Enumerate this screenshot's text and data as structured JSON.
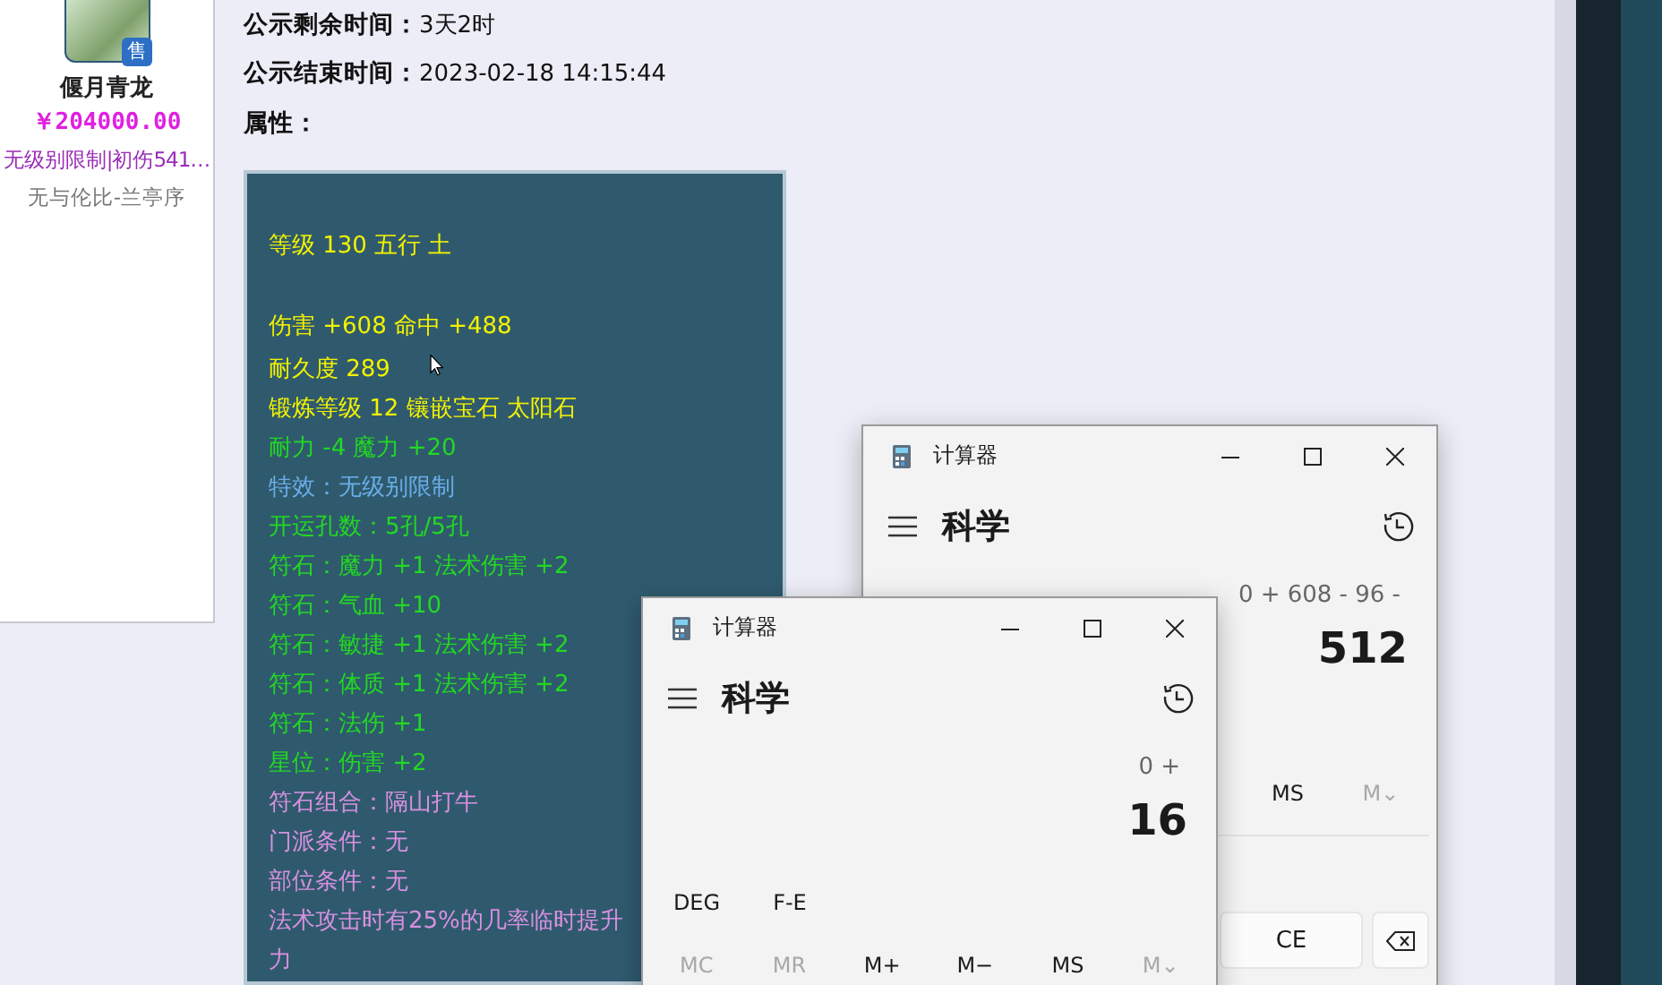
{
  "sidebar": {
    "badge": "售",
    "item_name": "偃月青龙",
    "price": "￥204000.00",
    "tags": "无级别限制|初伤541…",
    "seller": "无与伦比-兰亭序"
  },
  "details": [
    {
      "label": "公示剩余时间：",
      "value": "3天2时"
    },
    {
      "label": "公示结束时间：",
      "value": "2023-02-18 14:15:44"
    }
  ],
  "attributes": {
    "label": "属性：",
    "lines": [
      {
        "text": "等级 130 五行 土",
        "color": "#f2f200",
        "gap_before": true
      },
      {
        "text": "伤害 +608 命中 +488",
        "color": "#f2f200",
        "gap_before": true
      },
      {
        "text": "耐久度 289",
        "color": "#f2f200",
        "gap_before": false
      },
      {
        "text": "锻炼等级 12 镶嵌宝石 太阳石",
        "color": "#f2f200",
        "gap_before": false
      },
      {
        "text": "耐力 -4 魔力 +20",
        "color": "#22d822",
        "gap_before": false
      },
      {
        "text": "特效：无级别限制",
        "color": "#6aaee8",
        "gap_before": false
      },
      {
        "text": "开运孔数：5孔/5孔",
        "color": "#22d822",
        "gap_before": false
      },
      {
        "text": "符石：魔力 +1 法术伤害 +2",
        "color": "#22d822",
        "gap_before": false
      },
      {
        "text": "符石：气血 +10",
        "color": "#22d822",
        "gap_before": false
      },
      {
        "text": "符石：敏捷 +1 法术伤害 +2",
        "color": "#22d822",
        "gap_before": false
      },
      {
        "text": "符石：体质 +1 法术伤害 +2",
        "color": "#22d822",
        "gap_before": false
      },
      {
        "text": "符石：法伤 +1",
        "color": "#22d822",
        "gap_before": false
      },
      {
        "text": "星位：伤害 +2",
        "color": "#22d822",
        "gap_before": false
      },
      {
        "text": "符石组合：隔山打牛",
        "color": "#d890e0",
        "gap_before": false
      },
      {
        "text": "门派条件：无",
        "color": "#d890e0",
        "gap_before": false
      },
      {
        "text": "部位条件：无",
        "color": "#d890e0",
        "gap_before": false
      },
      {
        "text": "法术攻击时有25%的几率临时提升",
        "color": "#d890e0",
        "gap_before": false
      },
      {
        "text": "力",
        "color": "#d890e0",
        "gap_before": false
      }
    ]
  },
  "calculators": [
    {
      "title": "计算器",
      "mode": "科学",
      "expression": "0 + 608 - 96 -",
      "result": "512",
      "memory_keys": [
        {
          "label": "MS",
          "disabled": false
        },
        {
          "label": "M⌄",
          "disabled": true
        }
      ],
      "keys": [
        {
          "kind": "text",
          "label": "CE"
        },
        {
          "kind": "backspace"
        }
      ]
    },
    {
      "title": "计算器",
      "mode": "科学",
      "expression": "0 +",
      "result": "16",
      "angle_keys": [
        "DEG",
        "F-E"
      ],
      "memory_keys": [
        {
          "label": "MC",
          "disabled": true
        },
        {
          "label": "MR",
          "disabled": true
        },
        {
          "label": "M+",
          "disabled": false
        },
        {
          "label": "M−",
          "disabled": false
        },
        {
          "label": "MS",
          "disabled": false
        },
        {
          "label": "M⌄",
          "disabled": true
        }
      ]
    }
  ]
}
